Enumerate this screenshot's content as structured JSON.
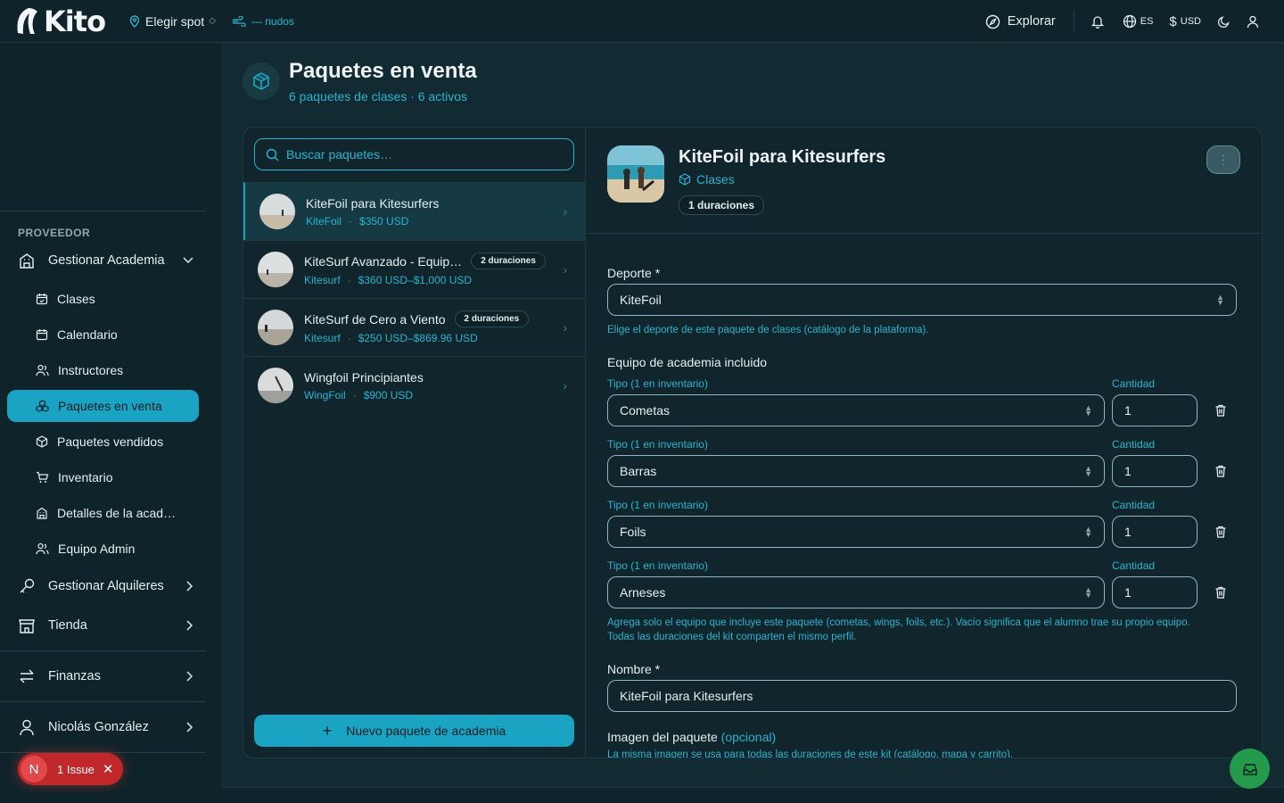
{
  "header": {
    "logo": "Kito",
    "spot_label": "Elegir spot",
    "wind_label": "— nudos",
    "explore_label": "Explorar",
    "language": "ES",
    "currency": "USD"
  },
  "sidebar": {
    "section_label": "PROVEEDOR",
    "academy_label": "Gestionar Academia",
    "sub_items": [
      {
        "label": "Clases"
      },
      {
        "label": "Calendario"
      },
      {
        "label": "Instructores"
      },
      {
        "label": "Paquetes en venta"
      },
      {
        "label": "Paquetes vendidos"
      },
      {
        "label": "Inventario"
      },
      {
        "label": "Detalles de la acad…"
      },
      {
        "label": "Equipo Admin"
      }
    ],
    "rentals_label": "Gestionar Alquileres",
    "store_label": "Tienda",
    "finance_label": "Finanzas",
    "user_label": "Nicolás González",
    "issue_avatar": "N",
    "issue_label": "1 Issue"
  },
  "page": {
    "title": "Paquetes en venta",
    "subtitle": "6 paquetes de clases · 6 activos"
  },
  "list": {
    "search_placeholder": "Buscar paquetes…",
    "items": [
      {
        "name": "KiteFoil para Kitesurfers",
        "sport": "KiteFoil",
        "price": "$350 USD",
        "badge": ""
      },
      {
        "name": "KiteSurf Avanzado - Equip…",
        "sport": "Kitesurf",
        "price": "$360 USD–$1,000 USD",
        "badge": "2 duraciones"
      },
      {
        "name": "KiteSurf de Cero a Viento",
        "sport": "Kitesurf",
        "price": "$250 USD–$869.96 USD",
        "badge": "2 duraciones"
      },
      {
        "name": "Wingfoil Principiantes",
        "sport": "WingFoil",
        "price": "$900 USD",
        "badge": ""
      }
    ],
    "new_button": "Nuevo paquete de academia"
  },
  "detail": {
    "title": "KiteFoil para Kitesurfers",
    "category": "Clases",
    "durations": "1 duraciones",
    "sport_label": "Deporte *",
    "sport_value": "KiteFoil",
    "sport_hint": "Elige el deporte de este paquete de clases (catálogo de la plataforma).",
    "equipment_label": "Equipo de academia incluido",
    "type_label": "Tipo (1 en inventario)",
    "qty_label": "Cantidad",
    "equipment": [
      {
        "type": "Cometas",
        "qty": "1"
      },
      {
        "type": "Barras",
        "qty": "1"
      },
      {
        "type": "Foils",
        "qty": "1"
      },
      {
        "type": "Arneses",
        "qty": "1"
      }
    ],
    "equipment_hint_1": "Agrega solo el equipo que incluye este paquete (cometas, wings, foils, etc.). Vacío significa que el alumno trae su propio equipo.",
    "equipment_hint_2": "Todas las duraciones del kit comparten el mismo perfil.",
    "name_label": "Nombre *",
    "name_value": "KiteFoil para Kitesurfers",
    "image_label": "Imagen del paquete",
    "image_optional": "(opcional)",
    "image_hint": "La misma imagen se usa para todas las duraciones de este kit (catálogo, mapa y carrito)."
  },
  "colors": {
    "accent": "#1ba3c4",
    "background": "#122a31",
    "sidebar": "#0f242a",
    "danger": "#c0282c",
    "fab": "#259a4a"
  }
}
